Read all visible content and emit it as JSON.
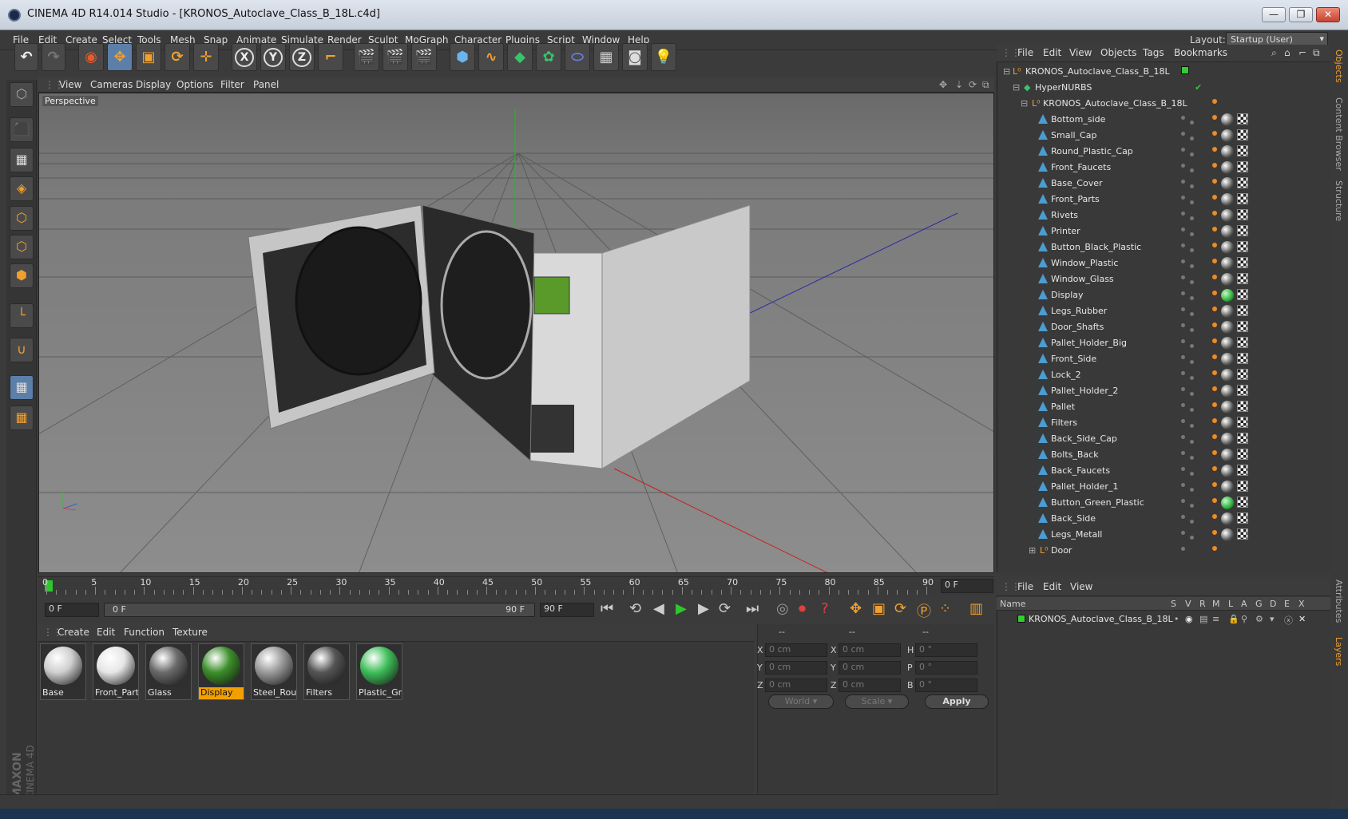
{
  "window": {
    "title": "CINEMA 4D R14.014 Studio - [KRONOS_Autoclave_Class_B_18L.c4d]",
    "minimize": "—",
    "maximize": "❐",
    "close": "✕"
  },
  "menubar": {
    "items": [
      "File",
      "Edit",
      "Create",
      "Select",
      "Tools",
      "Mesh",
      "Snap",
      "Animate",
      "Simulate",
      "Render",
      "Sculpt",
      "MoGraph",
      "Character",
      "Plugins",
      "Script",
      "Window",
      "Help"
    ],
    "layout_label": "Layout:",
    "layout_value": "Startup (User)"
  },
  "toolbar": {
    "axis_x": "X",
    "axis_y": "Y",
    "axis_z": "Z"
  },
  "viewport": {
    "menu": [
      "View",
      "Cameras",
      "Display",
      "Options",
      "Filter",
      "Panel"
    ],
    "label": "Perspective"
  },
  "timeline": {
    "ticks": [
      "0",
      "5",
      "10",
      "15",
      "20",
      "25",
      "30",
      "35",
      "40",
      "45",
      "50",
      "55",
      "60",
      "65",
      "70",
      "75",
      "80",
      "85",
      "90"
    ],
    "frame_field": "0 F",
    "start_field": "0 F",
    "slider_left": "0 F",
    "slider_right": "90 F",
    "end_field": "90 F"
  },
  "materials": {
    "menu": [
      "Create",
      "Edit",
      "Function",
      "Texture"
    ],
    "items": [
      {
        "name": "Base",
        "color": "#cfcfcf"
      },
      {
        "name": "Front_Parts",
        "color": "#e6e6e6"
      },
      {
        "name": "Glass",
        "color": "#6a6a6a"
      },
      {
        "name": "Display",
        "color": "#3c8f2a"
      },
      {
        "name": "Steel_Roug",
        "color": "#9a9a9a"
      },
      {
        "name": "Filters",
        "color": "#555555"
      },
      {
        "name": "Plastic_Gre",
        "color": "#3fbf5a"
      }
    ],
    "selected": "Display"
  },
  "coords": {
    "header": [
      "--",
      "--",
      "--"
    ],
    "rows": [
      {
        "l1": "X",
        "v1": "0 cm",
        "l2": "X",
        "v2": "0 cm",
        "l3": "H",
        "v3": "0 °"
      },
      {
        "l1": "Y",
        "v1": "0 cm",
        "l2": "Y",
        "v2": "0 cm",
        "l3": "P",
        "v3": "0 °"
      },
      {
        "l1": "Z",
        "v1": "0 cm",
        "l2": "Z",
        "v2": "0 cm",
        "l3": "B",
        "v3": "0 °"
      }
    ],
    "world": "World",
    "scale": "Scale",
    "apply": "Apply"
  },
  "objects": {
    "menu": [
      "File",
      "Edit",
      "View",
      "Objects",
      "Tags",
      "Bookmarks"
    ],
    "root": "KRONOS_Autoclave_Class_B_18L",
    "hypernurbs": "HyperNURBS",
    "group": "KRONOS_Autoclave_Class_B_18L",
    "children": [
      "Bottom_side",
      "Small_Cap",
      "Round_Plastic_Cap",
      "Front_Faucets",
      "Base_Cover",
      "Front_Parts",
      "Rivets",
      "Printer",
      "Button_Black_Plastic",
      "Window_Plastic",
      "Window_Glass",
      "Display",
      "Legs_Rubber",
      "Door_Shafts",
      "Pallet_Holder_Big",
      "Front_Side",
      "Lock_2",
      "Pallet_Holder_2",
      "Pallet",
      "Filters",
      "Back_Side_Cap",
      "Bolts_Back",
      "Back_Faucets",
      "Pallet_Holder_1",
      "Button_Green_Plastic",
      "Back_Side",
      "Legs_Metall"
    ],
    "door": "Door"
  },
  "layers": {
    "menu": [
      "File",
      "Edit",
      "View"
    ],
    "columns": [
      "Name",
      "S",
      "V",
      "R",
      "M",
      "L",
      "A",
      "G",
      "D",
      "E",
      "X"
    ],
    "row": "KRONOS_Autoclave_Class_B_18L",
    "color": "#33cc33"
  },
  "sidetabs": [
    "Objects",
    "Content Browser",
    "Structure",
    "Attributes",
    "Layers"
  ],
  "logo": {
    "maxon": "MAXON",
    "cinema": "CINEMA 4D"
  }
}
